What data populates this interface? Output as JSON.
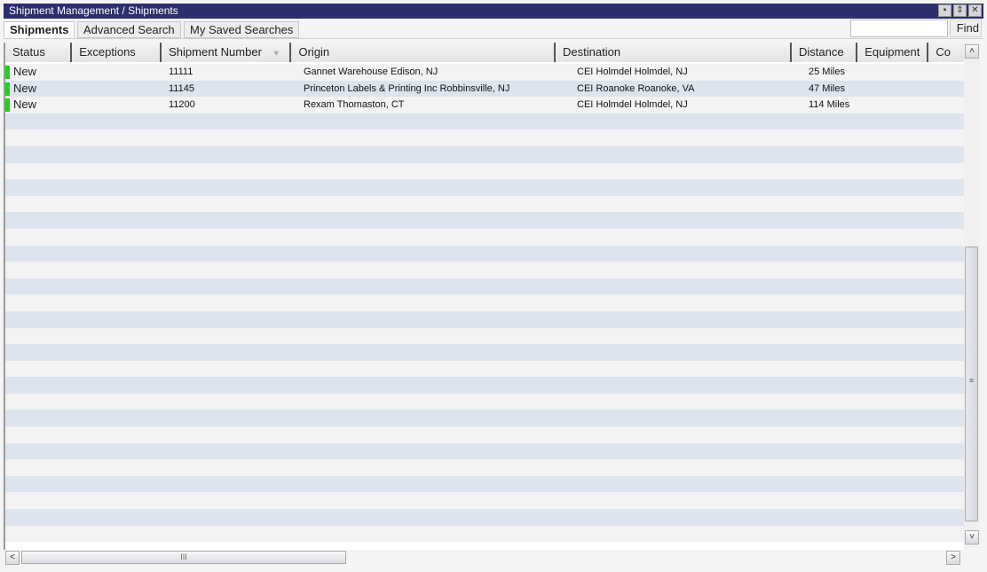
{
  "window": {
    "title": "Shipment Management / Shipments",
    "title_buttons": [
      {
        "name": "save-icon",
        "glyph": "▪"
      },
      {
        "name": "refresh-icon",
        "glyph": "⇕"
      },
      {
        "name": "close-icon",
        "glyph": "✕"
      }
    ]
  },
  "tabs": [
    {
      "label": "Shipments",
      "active": true
    },
    {
      "label": "Advanced Search",
      "active": false
    },
    {
      "label": "My Saved Searches",
      "active": false
    }
  ],
  "search": {
    "value": "",
    "placeholder": "",
    "find_label": "Find"
  },
  "grid": {
    "columns": [
      {
        "label": "Status"
      },
      {
        "label": "Exceptions"
      },
      {
        "label": "Shipment Number",
        "sorted": true
      },
      {
        "label": "Origin"
      },
      {
        "label": "Destination"
      },
      {
        "label": "Distance"
      },
      {
        "label": "Equipment"
      },
      {
        "label": "Co"
      }
    ],
    "sort_arrow_glyph": "▼",
    "status_color": "#1ed21e",
    "rows": [
      {
        "status": "New",
        "exceptions": "",
        "shipment_number": "11111",
        "origin": "Gannet Warehouse Edison, NJ",
        "destination": "CEI Holmdel Holmdel, NJ",
        "distance": "25 Miles",
        "equipment": ""
      },
      {
        "status": "New",
        "exceptions": "",
        "shipment_number": "11145",
        "origin": "Princeton Labels & Printing Inc Robbinsville, NJ",
        "destination": "CEI Roanoke Roanoke, VA",
        "distance": "47 Miles",
        "equipment": ""
      },
      {
        "status": "New",
        "exceptions": "",
        "shipment_number": "11200",
        "origin": "Rexam Thomaston, CT",
        "destination": "CEI Holmdel Holmdel, NJ",
        "distance": "114 Miles",
        "equipment": ""
      }
    ]
  },
  "scrollbars": {
    "up_glyph": "˄",
    "down_glyph": "˅",
    "left_glyph": "<",
    "right_glyph": ">",
    "grip_v": "≡",
    "grip_h": "III"
  }
}
